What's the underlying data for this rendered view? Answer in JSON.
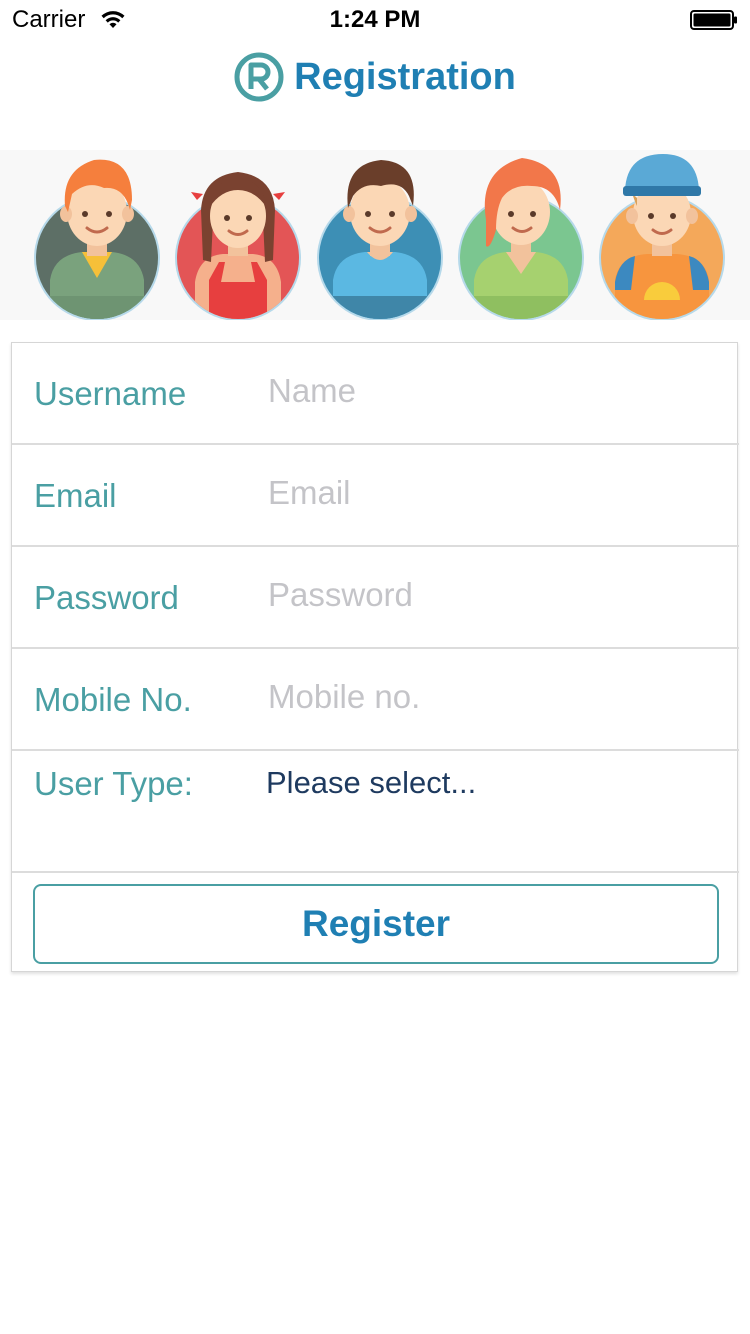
{
  "status_bar": {
    "carrier": "Carrier",
    "time": "1:24 PM",
    "wifi_icon": "wifi-icon",
    "battery_icon": "battery-icon"
  },
  "header": {
    "title": "Registration",
    "icon": "registered-icon",
    "color": "#1f7fb3"
  },
  "avatars": [
    {
      "name": "boy-avatar",
      "bg": "#5d6f66"
    },
    {
      "name": "girl-braids-avatar",
      "bg": "#e35556"
    },
    {
      "name": "boy-brown-hair-avatar",
      "bg": "#3d8fb5"
    },
    {
      "name": "girl-red-hair-avatar",
      "bg": "#7bc690"
    },
    {
      "name": "boy-cap-avatar",
      "bg": "#f4a85a"
    }
  ],
  "form": {
    "fields": [
      {
        "label": "Username",
        "placeholder": "Name"
      },
      {
        "label": "Email",
        "placeholder": "Email"
      },
      {
        "label": "Password",
        "placeholder": "Password"
      },
      {
        "label": "Mobile No.",
        "placeholder": "Mobile no."
      }
    ],
    "user_type": {
      "label": "User Type:",
      "selected": "Please select..."
    },
    "register_label": "Register",
    "label_color": "#4a9fa3"
  }
}
